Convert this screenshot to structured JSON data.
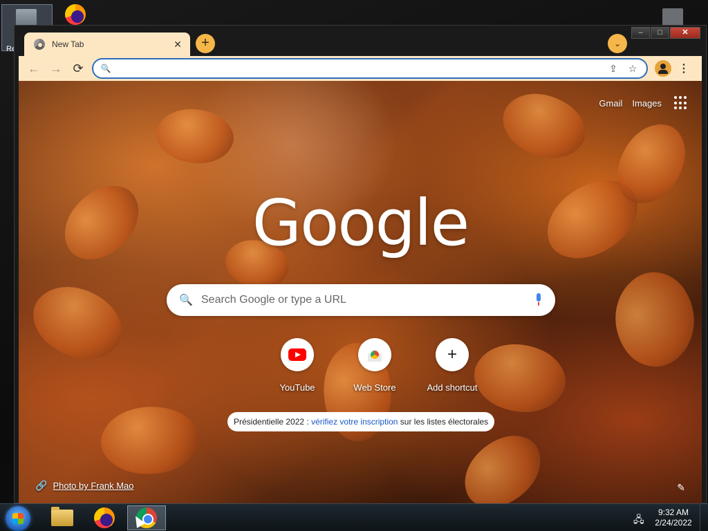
{
  "desktop": {
    "recycle_label": "Re"
  },
  "window": {
    "minimize_label": "–",
    "maximize_label": "□",
    "close_label": "✕"
  },
  "tab": {
    "title": "New Tab",
    "close_glyph": "✕",
    "new_tab_glyph": "+",
    "search_tabs_glyph": "⌄"
  },
  "toolbar": {
    "back_glyph": "←",
    "forward_glyph": "→",
    "reload_glyph": "⟳",
    "omnibox_value": "",
    "search_glyph": "🔍",
    "share_glyph": "⇪",
    "bookmark_glyph": "☆",
    "menu_glyph": "⋮"
  },
  "ntp": {
    "gmail": "Gmail",
    "images": "Images",
    "logo": "Google",
    "search_placeholder": "Search Google or type a URL",
    "shortcuts": [
      {
        "label": "YouTube",
        "icon": "youtube-icon"
      },
      {
        "label": "Web Store",
        "icon": "webstore-icon"
      },
      {
        "label": "Add shortcut",
        "icon": "plus-icon"
      }
    ],
    "promo": {
      "prefix": "Présidentielle 2022 : ",
      "link": "vérifiez votre inscription",
      "suffix": " sur les listes électorales"
    },
    "photo_credit": "Photo by Frank Mao",
    "credit_glyph": "🔗",
    "edit_glyph": "✎"
  },
  "taskbar": {
    "time": "9:32 AM",
    "date": "2/24/2022",
    "network_glyph": "🖧"
  },
  "colors": {
    "accent": "#f5b74a",
    "toolbar_bg": "#fde7c2",
    "omnibox_border": "#2d6cc0",
    "link": "#1a56c4"
  }
}
